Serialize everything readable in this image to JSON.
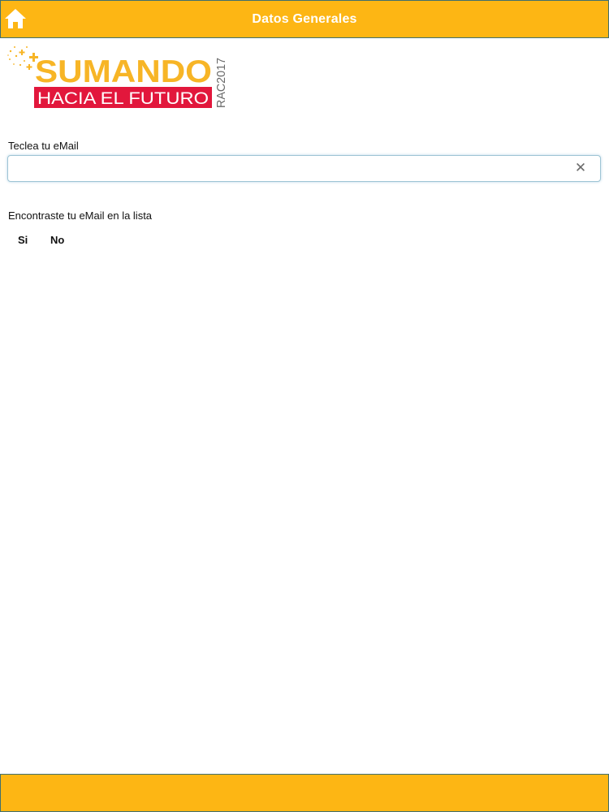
{
  "header": {
    "title": "Datos Generales",
    "home_icon": "home-icon"
  },
  "logo": {
    "line1": "SUMANDO",
    "line2": "HACIA EL FUTURO",
    "side_text": "RAC2017"
  },
  "form": {
    "email_label": "Teclea tu eMail",
    "email_value": "",
    "email_placeholder": "",
    "clear_icon": "close-icon",
    "clear_symbol": "✕",
    "found_label": "Encontraste tu eMail en la lista",
    "options": [
      "Si",
      "No"
    ]
  },
  "colors": {
    "bar": "#FDB614",
    "bar_border": "#3f6f6f",
    "logo_yellow": "#F7B526",
    "logo_red": "#E2173C",
    "logo_gray": "#6b6b6b"
  }
}
